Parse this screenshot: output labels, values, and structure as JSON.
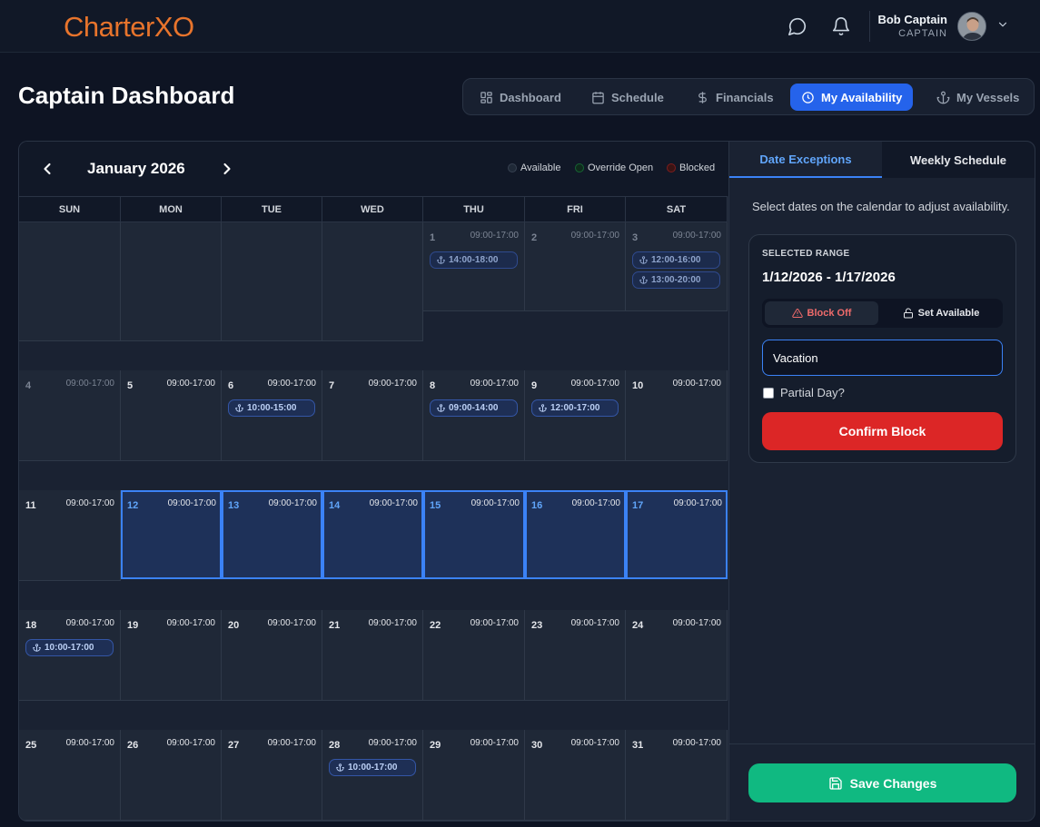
{
  "brand": {
    "logo_text": "Charter",
    "logo_accent": "XO",
    "color": "#e8742c"
  },
  "user": {
    "name": "Bob Captain",
    "role": "CAPTAIN"
  },
  "page_title": "Captain Dashboard",
  "nav_tabs": [
    {
      "label": "Dashboard",
      "icon": "grid-icon",
      "active": false
    },
    {
      "label": "Schedule",
      "icon": "calendar-icon",
      "active": false
    },
    {
      "label": "Financials",
      "icon": "dollar-icon",
      "active": false
    },
    {
      "label": "My Availability",
      "icon": "clock-icon",
      "active": true
    },
    {
      "label": "My Vessels",
      "icon": "anchor-icon",
      "active": false
    }
  ],
  "calendar": {
    "month_label": "January 2026",
    "legend": [
      {
        "label": "Available",
        "color": "#374151"
      },
      {
        "label": "Override Open",
        "color": "#166534"
      },
      {
        "label": "Blocked",
        "color": "#7f1d1d"
      }
    ],
    "weekdays": [
      "SUN",
      "MON",
      "TUE",
      "WED",
      "THU",
      "FRI",
      "SAT"
    ],
    "default_hours": "09:00-17:00",
    "first_weekday_index": 4,
    "days_in_month": 31,
    "selected_days": [
      12,
      13,
      14,
      15,
      16,
      17
    ],
    "dimmed_days": [
      1,
      2,
      3,
      4
    ],
    "bookings": [
      {
        "day": 1,
        "slots": [
          "14:00-18:00"
        ]
      },
      {
        "day": 3,
        "slots": [
          "12:00-16:00",
          "13:00-20:00"
        ]
      },
      {
        "day": 6,
        "slots": [
          "10:00-15:00"
        ]
      },
      {
        "day": 8,
        "slots": [
          "09:00-14:00"
        ]
      },
      {
        "day": 9,
        "slots": [
          "12:00-17:00"
        ]
      },
      {
        "day": 18,
        "slots": [
          "10:00-17:00"
        ]
      },
      {
        "day": 28,
        "slots": [
          "10:00-17:00"
        ]
      }
    ]
  },
  "side_panel": {
    "tabs": [
      {
        "label": "Date Exceptions",
        "active": true
      },
      {
        "label": "Weekly Schedule",
        "active": false
      }
    ],
    "hint": "Select dates on the calendar to adjust availability.",
    "selected_range_label": "SELECTED RANGE",
    "selected_range_value": "1/12/2026 - 1/17/2026",
    "mode_block_label": "Block Off",
    "mode_available_label": "Set Available",
    "reason_value": "Vacation",
    "partial_day_label": "Partial Day?",
    "partial_day_checked": false,
    "confirm_label": "Confirm Block",
    "save_label": "Save Changes"
  }
}
